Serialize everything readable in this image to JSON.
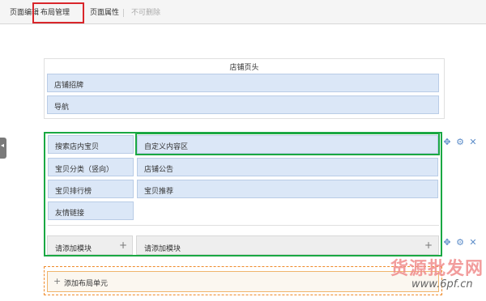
{
  "tabs": [
    {
      "label": "页面编辑"
    },
    {
      "label": "布局管理"
    },
    {
      "label": "页面属性"
    },
    {
      "label": "不可删除"
    }
  ],
  "header_section": {
    "title": "店铺页头",
    "bars": [
      {
        "label": "店铺招牌"
      },
      {
        "label": "导航"
      }
    ]
  },
  "body_section": {
    "left_modules": [
      {
        "label": "搜索店内宝贝"
      },
      {
        "label": "宝贝分类（竖向）"
      },
      {
        "label": "宝贝排行榜"
      },
      {
        "label": "友情链接"
      }
    ],
    "right_modules": [
      {
        "label": "自定义内容区"
      },
      {
        "label": "店铺公告"
      },
      {
        "label": "宝贝推荐"
      }
    ],
    "add_module_left": "请添加模块",
    "add_module_right": "请添加模块"
  },
  "add_layout_unit": "添加布局单元",
  "icons": {
    "plus": "+",
    "move": "✥",
    "gear": "⚙",
    "close": "✕",
    "handle": "◂"
  },
  "watermark": {
    "text": "货源批发网",
    "url": "www.6pf.cn"
  },
  "colors": {
    "highlight_red": "#d9262b",
    "selection_green": "#1aa843",
    "add_orange": "#ef8a2a",
    "module_blue": "#dbe7f7"
  }
}
